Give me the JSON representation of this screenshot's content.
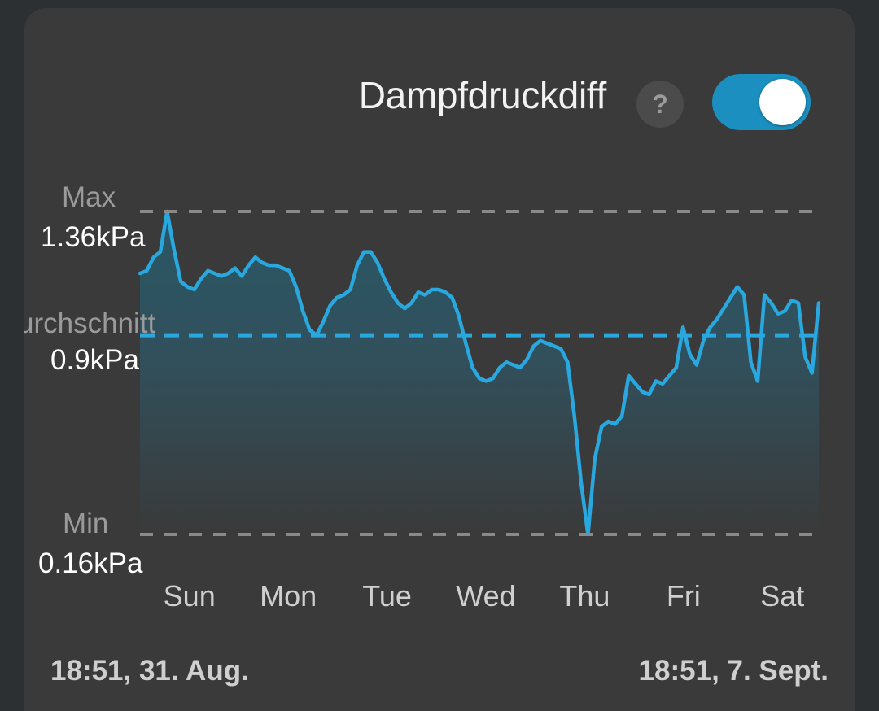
{
  "card": {
    "background": "#3a3a3a",
    "page_background": "#2c3033"
  },
  "header": {
    "title": "Dampfdruckdiff",
    "help_icon": "question-mark-icon",
    "help_glyph": "?",
    "toggle": {
      "state": "on",
      "accent_color": "#1b8fbf",
      "knob_color": "#ffffff"
    }
  },
  "stats": {
    "max_label": "Max",
    "max_value": "1.36kPa",
    "avg_label": "urchschnitt",
    "avg_value": "0.9kPa",
    "min_label": "Min",
    "min_value": "0.16kPa"
  },
  "axis": {
    "days": [
      "Sun",
      "Mon",
      "Tue",
      "Wed",
      "Thu",
      "Fri",
      "Sat"
    ]
  },
  "range": {
    "start": "18:51,  31. Aug.",
    "end": "18:51,  7. Sept."
  },
  "chart_data": {
    "type": "area",
    "title": "Dampfdruckdiff",
    "xlabel": "",
    "ylabel": "kPa",
    "unit": "kPa",
    "ylim": [
      0.16,
      1.36
    ],
    "grid": true,
    "legend": "none",
    "line_color": "#29a8e0",
    "fill_top_color": "#2a5765",
    "fill_bottom_color": "#3a3a3a",
    "reference_lines": [
      {
        "name": "Max",
        "value": 1.36,
        "label": "1.36kPa",
        "color": "#8a8a8a",
        "style": "dashed"
      },
      {
        "name": "Durchschnitt",
        "value": 0.9,
        "label": "0.9kPa",
        "color": "#29a8e0",
        "style": "dashed"
      },
      {
        "name": "Min",
        "value": 0.16,
        "label": "0.16kPa",
        "color": "#8a8a8a",
        "style": "dashed"
      }
    ],
    "categories": [
      "Sun",
      "Mon",
      "Tue",
      "Wed",
      "Thu",
      "Fri",
      "Sat"
    ],
    "x": [
      0.0,
      0.01,
      0.02,
      0.03,
      0.04,
      0.05,
      0.06,
      0.07,
      0.08,
      0.09,
      0.1,
      0.11,
      0.12,
      0.13,
      0.14,
      0.15,
      0.16,
      0.17,
      0.18,
      0.19,
      0.2,
      0.21,
      0.22,
      0.23,
      0.24,
      0.25,
      0.26,
      0.27,
      0.28,
      0.29,
      0.3,
      0.31,
      0.32,
      0.33,
      0.34,
      0.35,
      0.36,
      0.37,
      0.38,
      0.39,
      0.4,
      0.41,
      0.42,
      0.43,
      0.44,
      0.45,
      0.46,
      0.47,
      0.48,
      0.49,
      0.5,
      0.51,
      0.52,
      0.53,
      0.54,
      0.55,
      0.56,
      0.57,
      0.58,
      0.59,
      0.6,
      0.61,
      0.62,
      0.63,
      0.64,
      0.65,
      0.66,
      0.67,
      0.68,
      0.69,
      0.7,
      0.71,
      0.72,
      0.73,
      0.74,
      0.75,
      0.76,
      0.77,
      0.78,
      0.79,
      0.8,
      0.81,
      0.82,
      0.83,
      0.84,
      0.85,
      0.86,
      0.87,
      0.88,
      0.89,
      0.9,
      0.91,
      0.92,
      0.93,
      0.94,
      0.95,
      0.96,
      0.97,
      0.98,
      0.99,
      1.0
    ],
    "values": [
      1.13,
      1.14,
      1.19,
      1.21,
      1.36,
      1.22,
      1.1,
      1.08,
      1.07,
      1.11,
      1.14,
      1.13,
      1.12,
      1.13,
      1.15,
      1.12,
      1.16,
      1.19,
      1.17,
      1.16,
      1.16,
      1.15,
      1.14,
      1.08,
      0.99,
      0.92,
      0.9,
      0.95,
      1.01,
      1.04,
      1.05,
      1.07,
      1.16,
      1.21,
      1.21,
      1.17,
      1.11,
      1.06,
      1.02,
      1.0,
      1.02,
      1.06,
      1.05,
      1.07,
      1.07,
      1.06,
      1.04,
      0.97,
      0.87,
      0.78,
      0.74,
      0.73,
      0.74,
      0.78,
      0.8,
      0.79,
      0.78,
      0.81,
      0.86,
      0.88,
      0.87,
      0.86,
      0.85,
      0.8,
      0.6,
      0.35,
      0.16,
      0.44,
      0.56,
      0.58,
      0.57,
      0.6,
      0.75,
      0.72,
      0.69,
      0.68,
      0.73,
      0.72,
      0.75,
      0.78,
      0.93,
      0.83,
      0.79,
      0.88,
      0.93,
      0.96,
      1.0,
      1.04,
      1.08,
      1.05,
      0.8,
      0.73,
      1.05,
      1.02,
      0.98,
      0.99,
      1.03,
      1.02,
      0.82,
      0.76,
      1.02
    ]
  }
}
